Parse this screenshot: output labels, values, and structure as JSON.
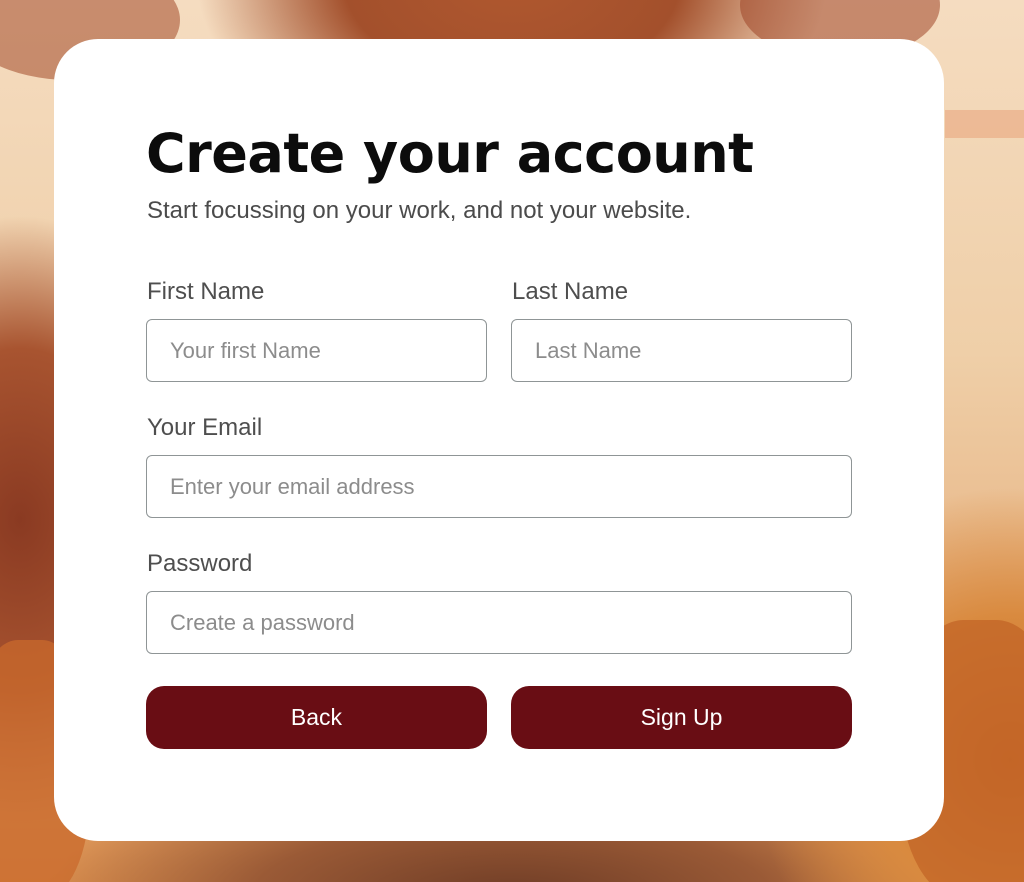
{
  "form": {
    "title": "Create your account",
    "subtitle": "Start focussing on your work, and not your website.",
    "first_name": {
      "label": "First Name",
      "placeholder": "Your first Name"
    },
    "last_name": {
      "label": "Last Name",
      "placeholder": "Last Name"
    },
    "email": {
      "label": "Your Email",
      "placeholder": "Enter your email address"
    },
    "password": {
      "label": "Password",
      "placeholder": "Create a password"
    },
    "back_label": "Back",
    "signup_label": "Sign Up"
  },
  "colors": {
    "button": "#690d14",
    "card": "#ffffff",
    "title_text": "#0c0c0c"
  }
}
